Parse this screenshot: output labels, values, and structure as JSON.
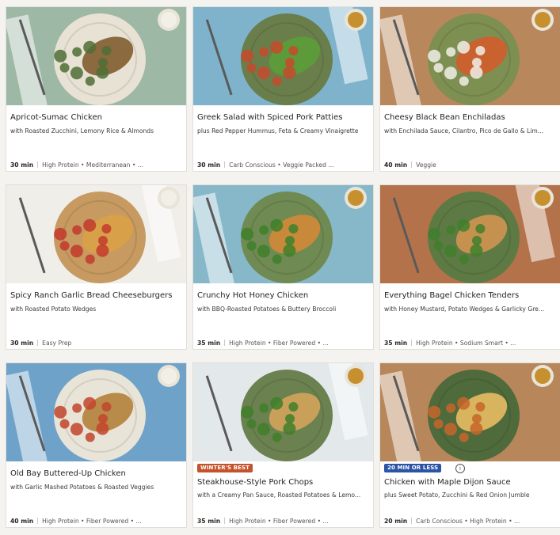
{
  "recipes": [
    {
      "title": "Apricot-Sumac Chicken",
      "subtitle": "with Roasted Zucchini, Lemony Rice & Almonds",
      "time": "30 min",
      "tags": "High Protein • Mediterranean • ...",
      "bg": "#9eb8a6",
      "plate": "#e8e2d4",
      "food": "#8a6a3e",
      "accent": "#4f6f35"
    },
    {
      "title": "Greek Salad with Spiced Pork Patties",
      "subtitle": "plus Red Pepper Hummus, Feta & Creamy Vinaigrette",
      "time": "30 min",
      "tags": "Carb Conscious • Veggie Packed ...",
      "bg": "#7fb3cc",
      "plate": "#6a7e4c",
      "food": "#5c9a3a",
      "accent": "#c74a2c"
    },
    {
      "title": "Cheesy Black Bean Enchiladas",
      "subtitle": "with Enchilada Sauce, Cilantro, Pico de Gallo & Lim...",
      "time": "40 min",
      "tags": "Veggie",
      "bg": "#b9875c",
      "plate": "#7e8f52",
      "food": "#c9622f",
      "accent": "#f1efe8"
    },
    {
      "title": "Spicy Ranch Garlic Bread Cheeseburgers",
      "subtitle": "with Roasted Potato Wedges",
      "time": "30 min",
      "tags": "Easy Prep",
      "bg": "#f0eee9",
      "plate": "#c79a61",
      "food": "#d9a04a",
      "accent": "#c2392b"
    },
    {
      "title": "Crunchy Hot Honey Chicken",
      "subtitle": "with BBQ-Roasted Potatoes & Buttery Broccoli",
      "time": "35 min",
      "tags": "High Protein • Fiber Powered • ...",
      "bg": "#86b8c9",
      "plate": "#6f8a52",
      "food": "#c88a3a",
      "accent": "#3f7f2a"
    },
    {
      "title": "Everything Bagel Chicken Tenders",
      "subtitle": "with Honey Mustard, Potato Wedges & Garlicky Gre...",
      "time": "35 min",
      "tags": "High Protein • Sodium Smart • ...",
      "bg": "#b4724a",
      "plate": "#5e7a44",
      "food": "#c4914f",
      "accent": "#3f7f2a"
    },
    {
      "title": "Old Bay Buttered-Up Chicken",
      "subtitle": "with Garlic Mashed Potatoes & Roasted Veggies",
      "time": "40 min",
      "tags": "High Protein • Fiber Powered • ...",
      "bg": "#6fa2c9",
      "plate": "#e9e4d8",
      "food": "#b98b4a",
      "accent": "#c2452b"
    },
    {
      "title": "Steakhouse-Style Pork Chops",
      "subtitle": "with a Creamy Pan Sauce, Roasted Potatoes & Lemo...",
      "time": "35 min",
      "tags": "High Protein • Fiber Powered • ...",
      "bg": "#e3e8ea",
      "plate": "#6b8150",
      "food": "#c8a05a",
      "accent": "#3f7f2a",
      "badge": "WINTER'S BEST",
      "badge_color": "orange"
    },
    {
      "title": "Chicken with Maple Dijon Sauce",
      "subtitle": "plus Sweet Potato, Zucchini & Red Onion Jumble",
      "time": "20 min",
      "tags": "Carb Conscious • High Protein • ...",
      "bg": "#b7865a",
      "plate": "#4f6b3c",
      "food": "#d9b45e",
      "accent": "#c7652a",
      "badge": "20 MIN OR LESS",
      "badge_color": "blue",
      "info": "ⓘ"
    }
  ]
}
